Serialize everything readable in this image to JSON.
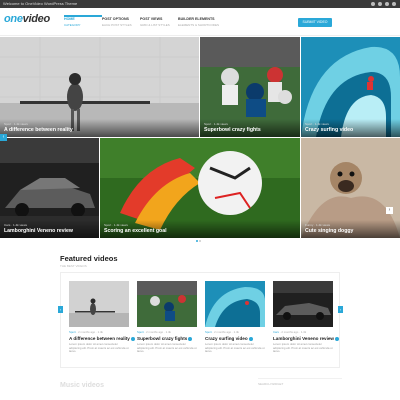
{
  "topbar": {
    "text": "Welcome to OneVideo WordPress Theme"
  },
  "header": {
    "logo_one": "one",
    "logo_video": "video",
    "nav": [
      {
        "label": "HOME",
        "sub": "CATEGORY"
      },
      {
        "label": "POST OPTIONS",
        "sub": "EACH POST STYLES"
      },
      {
        "label": "POST VIEWS",
        "sub": "GRID & LIST STYLES"
      },
      {
        "label": "BUILDER ELEMENTS",
        "sub": "ELEMENTS & SHORTCODES"
      }
    ],
    "submit_label": "SUBMIT VIDEO"
  },
  "hero": [
    {
      "meta": "Sport · 1.4k views",
      "title": "A difference between reality"
    },
    {
      "meta": "Sport · 1.4k views",
      "title": "Superbowl crazy fights"
    },
    {
      "meta": "Sport · 1.4k views",
      "title": "Crazy surfing video"
    },
    {
      "meta": "Cars · 1.4k views",
      "title": "Lamborghini Veneno review"
    },
    {
      "meta": "Sport · 1.4k views",
      "title": "Scoring an excellent goal"
    },
    {
      "meta": "Funny · 1.4k views",
      "title": "Cute singing doggy"
    }
  ],
  "featured": {
    "title": "Featured videos",
    "subtitle": "THE BEST VIDEOS",
    "cards": [
      {
        "cat": "Sport",
        "meta": "· 2 months ago · 1.4k",
        "title": "A difference between reality",
        "desc": "Lorem ipsum dolor sit amet consectetur adipiscing elit. Proin at mauris ac est vehicula ut lacus."
      },
      {
        "cat": "Sport",
        "meta": "· 2 months ago · 1.4k",
        "title": "Superbowl crazy fights",
        "desc": "Lorem ipsum dolor sit amet consectetur adipiscing elit. Proin at mauris ac est vehicula ut lacus."
      },
      {
        "cat": "Sport",
        "meta": "· 2 months ago · 1.4k",
        "title": "Crazy surfing video",
        "desc": "Lorem ipsum dolor sit amet consectetur adipiscing elit. Proin at mauris ac est vehicula ut lacus."
      },
      {
        "cat": "Cars",
        "meta": "· 2 months ago · 1.4k",
        "title": "Lamborghini Veneno review",
        "desc": "Lorem ipsum dolor sit amet consectetur adipiscing elit. Proin at mauris ac est vehicula ut lacus."
      }
    ]
  },
  "music": {
    "title": "Music videos"
  },
  "sidebar": {
    "widget_title": "SEARCH WIDGET"
  },
  "colors": {
    "accent": "#2aa8d8"
  }
}
